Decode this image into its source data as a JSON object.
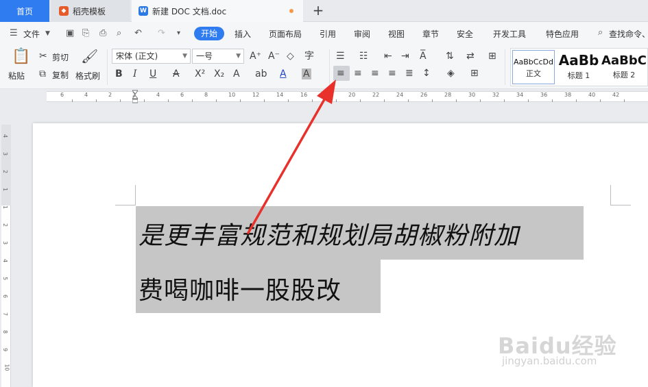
{
  "tabs": {
    "home": "首页",
    "template": "稻壳模板",
    "document": "新建 DOC 文档.doc",
    "new_tab": "+"
  },
  "menu": {
    "file": "文件",
    "start": "开始",
    "insert": "插入",
    "layout": "页面布局",
    "reference": "引用",
    "review": "审阅",
    "view": "视图",
    "section": "章节",
    "security": "安全",
    "developer": "开发工具",
    "features": "特色应用",
    "search": "查找命令、"
  },
  "ribbon": {
    "paste": "粘贴",
    "cut": "剪切",
    "copy": "复制",
    "format_painter": "格式刷",
    "font_name": "宋体 (正文)",
    "font_size": "一号",
    "bold": "B",
    "italic": "I",
    "underline": "U",
    "styles": [
      {
        "sample": "AaBbCcDd",
        "name": "正文"
      },
      {
        "sample": "AaBb",
        "name": "标题 1"
      },
      {
        "sample": "AaBbC",
        "name": "标题 2"
      }
    ]
  },
  "ruler": {
    "labels": [
      "6",
      "4",
      "2",
      "2",
      "4",
      "6",
      "8",
      "10",
      "12",
      "14",
      "16",
      "18",
      "20",
      "22",
      "24",
      "26",
      "28",
      "30",
      "32",
      "34",
      "36",
      "38",
      "40",
      "42"
    ],
    "vertical_labels": [
      "4",
      "3",
      "2",
      "1",
      "1",
      "2",
      "3",
      "4",
      "5",
      "6",
      "7",
      "8",
      "9",
      "10"
    ]
  },
  "document": {
    "line1": "是更丰富规范和规划局胡椒粉附加",
    "line2": "费喝咖啡一股股改"
  },
  "watermark": {
    "main": "Baidu经验",
    "sub": "jingyan.baidu.com"
  },
  "colors": {
    "accent": "#2f7bf0",
    "selection": "#c6c6c6",
    "arrow": "#e8312b"
  }
}
